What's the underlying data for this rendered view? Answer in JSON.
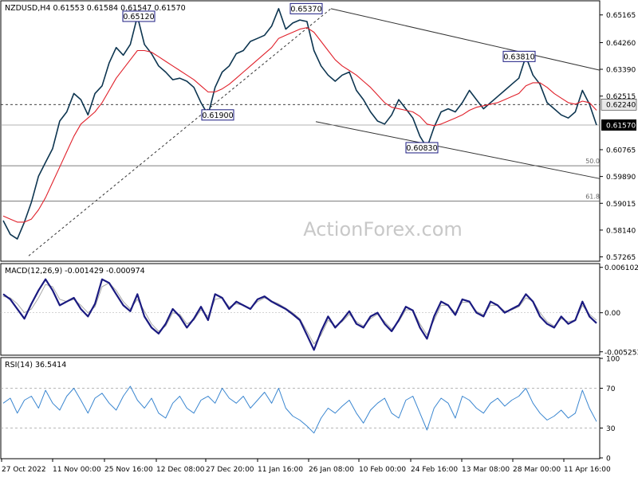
{
  "colors": {
    "price": "#0d3550",
    "ma": "#e0202a",
    "macd": "#1a1a80",
    "signal": "#a8a8a8",
    "rsi": "#3a86d0",
    "grid": "#000000",
    "dashed": "#a0a0a0",
    "watermark": "#c8c8c8"
  },
  "header": {
    "price_info": "NZDUSD,H4  0.61553 0.61584 0.61547 0.61570",
    "macd_info": "MACD(12,26,9) -0.001429 -0.000974",
    "rsi_info": "RSI(14) 36.5414"
  },
  "watermark": "ActionForex.com",
  "chart_data": [
    {
      "type": "line",
      "title": "NZDUSD,H4",
      "x": [
        "27 Oct 2022",
        "11 Nov 00:00",
        "25 Nov 16:00",
        "12 Dec 08:00",
        "27 Dec 20:00",
        "11 Jan 16:00",
        "26 Jan 08:00",
        "10 Feb 00:00",
        "24 Feb 16:00",
        "13 Mar 08:00",
        "28 Mar 00:00",
        "11 Apr 16:00"
      ],
      "ylim": [
        0.5715,
        0.656
      ],
      "y_ticks": [
        "0.65165",
        "0.64260",
        "0.63390",
        "0.62515",
        "0.61570",
        "0.60765",
        "0.59890",
        "0.59015",
        "0.58140",
        "0.57265"
      ],
      "series": [
        {
          "values": [
            0.5845,
            0.58,
            0.5785,
            0.584,
            0.5905,
            0.599,
            0.6035,
            0.608,
            0.617,
            0.62,
            0.626,
            0.624,
            0.619,
            0.626,
            0.6285,
            0.636,
            0.641,
            0.6385,
            0.642,
            0.6512,
            0.642,
            0.639,
            0.635,
            0.633,
            0.6305,
            0.631,
            0.63,
            0.628,
            0.623,
            0.619,
            0.628,
            0.633,
            0.635,
            0.639,
            0.64,
            0.643,
            0.644,
            0.645,
            0.648,
            0.6537,
            0.647,
            0.649,
            0.65,
            0.6495,
            0.64,
            0.635,
            0.632,
            0.63,
            0.632,
            0.633,
            0.627,
            0.624,
            0.62,
            0.617,
            0.616,
            0.619,
            0.624,
            0.621,
            0.618,
            0.612,
            0.6083,
            0.615,
            0.62,
            0.621,
            0.62,
            0.623,
            0.627,
            0.624,
            0.621,
            0.623,
            0.625,
            0.627,
            0.629,
            0.631,
            0.6381,
            0.632,
            0.629,
            0.623,
            0.621,
            0.619,
            0.618,
            0.62,
            0.627,
            0.6225,
            0.6157
          ]
        },
        {
          "values": [
            0.586,
            0.585,
            0.584,
            0.584,
            0.585,
            0.588,
            0.592,
            0.597,
            0.602,
            0.607,
            0.612,
            0.616,
            0.618,
            0.62,
            0.623,
            0.627,
            0.631,
            0.634,
            0.637,
            0.64,
            0.64,
            0.6395,
            0.638,
            0.6365,
            0.635,
            0.6335,
            0.632,
            0.6305,
            0.6285,
            0.6265,
            0.6265,
            0.6275,
            0.629,
            0.631,
            0.633,
            0.635,
            0.637,
            0.639,
            0.641,
            0.644,
            0.645,
            0.646,
            0.647,
            0.6475,
            0.646,
            0.643,
            0.64,
            0.637,
            0.635,
            0.6335,
            0.632,
            0.63,
            0.628,
            0.6255,
            0.623,
            0.6215,
            0.621,
            0.6205,
            0.62,
            0.6185,
            0.616,
            0.6155,
            0.616,
            0.617,
            0.618,
            0.619,
            0.6205,
            0.6215,
            0.622,
            0.6225,
            0.623,
            0.624,
            0.625,
            0.626,
            0.6285,
            0.6295,
            0.6295,
            0.628,
            0.626,
            0.6245,
            0.623,
            0.6225,
            0.6235,
            0.623,
            0.6205
          ]
        }
      ],
      "annotations": [
        {
          "label": "0.65120",
          "x": "25 Nov 16:00",
          "y": 0.6512
        },
        {
          "label": "0.65370",
          "x": "11 Jan 16:00",
          "y": 0.6537
        },
        {
          "label": "0.61900",
          "x": "27 Dec 20:00",
          "y": 0.619
        },
        {
          "label": "0.63810",
          "x": "28 Mar 00:00",
          "y": 0.6381
        },
        {
          "label": "0.60830",
          "x": "24 Feb 16:00",
          "y": 0.6083
        }
      ],
      "price_tags": [
        {
          "label": "0.62240",
          "y": 0.6224,
          "bg": "#e8e8e8",
          "fg": "#000000"
        },
        {
          "label": "0.61570",
          "y": 0.6157,
          "bg": "#000000",
          "fg": "#ffffff"
        }
      ],
      "fib_levels": [
        {
          "label": "50.0",
          "y": 0.6024
        },
        {
          "label": "61.8",
          "y": 0.5909
        }
      ],
      "dashed_level": 0.6224,
      "h_line": 0.6157
    },
    {
      "type": "line",
      "title": "MACD(12,26,9)",
      "ylim": [
        -0.0056,
        0.0065
      ],
      "y_ticks": [
        "0.006102",
        "0.00",
        "-0.005253"
      ],
      "series": [
        {
          "values": [
            0.0025,
            0.0018,
            0.0005,
            -0.0008,
            0.0012,
            0.003,
            0.0045,
            0.003,
            0.001,
            0.0015,
            0.002,
            0.0005,
            -0.0005,
            0.0012,
            0.0045,
            0.004,
            0.0025,
            0.001,
            0.0002,
            0.0025,
            -0.0005,
            -0.002,
            -0.0028,
            -0.0015,
            0.0005,
            -0.0005,
            -0.002,
            -0.0008,
            0.0008,
            -0.001,
            0.0025,
            0.002,
            0.0005,
            0.0015,
            0.001,
            0.0005,
            0.0018,
            0.0022,
            0.0015,
            0.001,
            0.0005,
            -0.0002,
            -0.001,
            -0.003,
            -0.005,
            -0.0025,
            -0.0005,
            -0.002,
            -0.001,
            0.0002,
            -0.0015,
            -0.002,
            -0.0005,
            0.0,
            -0.0015,
            -0.0025,
            -0.001,
            0.0008,
            0.0003,
            -0.002,
            -0.0035,
            -0.0005,
            0.0015,
            0.001,
            -0.0003,
            0.0018,
            0.0015,
            0.0,
            -0.0005,
            0.0015,
            0.001,
            0.0,
            0.0005,
            0.001,
            0.0025,
            0.0015,
            -0.0005,
            -0.0015,
            -0.002,
            -0.0005,
            -0.0015,
            -0.001,
            0.0015,
            -0.0005,
            -0.0014
          ]
        },
        {
          "values": [
            0.0022,
            0.002,
            0.0012,
            0.0,
            0.0005,
            0.002,
            0.0038,
            0.0035,
            0.0018,
            0.0015,
            0.0018,
            0.001,
            0.0,
            0.0008,
            0.0035,
            0.004,
            0.003,
            0.0015,
            0.0005,
            0.0018,
            0.0002,
            -0.0015,
            -0.0025,
            -0.0018,
            0.0,
            -0.0002,
            -0.0015,
            -0.001,
            0.0004,
            -0.0005,
            0.0018,
            0.002,
            0.0008,
            0.0012,
            0.001,
            0.0006,
            0.0015,
            0.002,
            0.0016,
            0.0012,
            0.0006,
            0.0,
            -0.0008,
            -0.0025,
            -0.0042,
            -0.003,
            -0.001,
            -0.0018,
            -0.0012,
            -0.0002,
            -0.0012,
            -0.0018,
            -0.0008,
            -0.0002,
            -0.0012,
            -0.0022,
            -0.0012,
            0.0004,
            0.0004,
            -0.0015,
            -0.003,
            -0.001,
            0.001,
            0.001,
            0.0,
            0.0014,
            0.0014,
            0.0002,
            -0.0003,
            0.001,
            0.001,
            0.0002,
            0.0004,
            0.0008,
            0.002,
            0.0016,
            0.0,
            -0.0012,
            -0.0018,
            -0.0008,
            -0.0012,
            -0.001,
            0.001,
            -0.0002,
            -0.001
          ]
        }
      ]
    },
    {
      "type": "line",
      "title": "RSI(14)",
      "ylim": [
        0,
        100
      ],
      "y_ticks": [
        "100",
        "70",
        "30",
        "0"
      ],
      "reference_lines": [
        70,
        30
      ],
      "series": [
        {
          "values": [
            55,
            60,
            45,
            58,
            62,
            50,
            68,
            55,
            48,
            62,
            70,
            58,
            45,
            60,
            65,
            55,
            48,
            62,
            72,
            58,
            50,
            60,
            45,
            40,
            55,
            62,
            50,
            45,
            58,
            62,
            55,
            70,
            60,
            55,
            62,
            50,
            58,
            66,
            55,
            70,
            50,
            42,
            38,
            32,
            25,
            40,
            50,
            45,
            52,
            58,
            45,
            35,
            48,
            55,
            60,
            45,
            40,
            58,
            62,
            45,
            28,
            50,
            60,
            55,
            40,
            62,
            58,
            50,
            45,
            55,
            60,
            52,
            58,
            62,
            70,
            55,
            45,
            38,
            42,
            48,
            40,
            45,
            68,
            50,
            36.5414
          ]
        }
      ]
    }
  ]
}
